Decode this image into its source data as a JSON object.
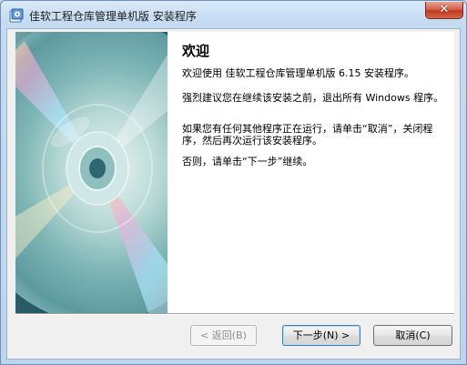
{
  "window": {
    "title": "佳软工程仓库管理单机版 安装程序",
    "close_label": "✕"
  },
  "content": {
    "heading": "欢迎",
    "paragraphs": [
      "欢迎使用 佳软工程仓库管理单机版 6.15 安装程序。",
      "强烈建议您在继续该安装之前，退出所有 Windows 程序。",
      "如果您有任何其他程序正在运行，请单击“取消”，关闭程序，然后再次运行该安装程序。",
      "否则，请单击“下一步”继续。"
    ]
  },
  "buttons": {
    "back": "< 返回(B)",
    "next": "下一步(N) >",
    "cancel": "取消(C)"
  },
  "colors": {
    "title_bar": "#c5dbf2",
    "close_button": "#c8412a",
    "content_bg": "#ffffff",
    "banner_bg": "#2c5f6a"
  }
}
